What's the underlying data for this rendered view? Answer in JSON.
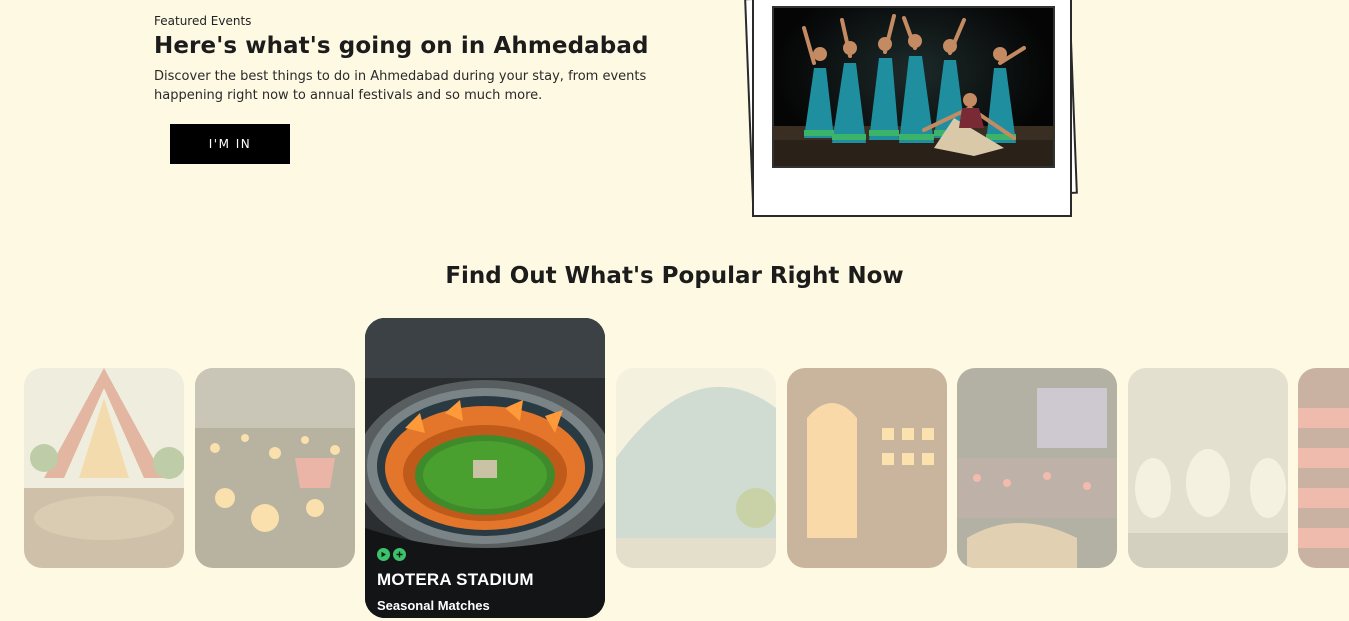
{
  "hero": {
    "eyebrow": "Featured Events",
    "title": "Here's what's going on in Ahmedabad",
    "description": "Discover the best things to do in Ahmedabad during your stay, from events happening right now to annual festivals and so much more.",
    "cta_label": "I'M IN"
  },
  "popular": {
    "title": "Find Out What's Popular Right Now",
    "active_card": {
      "name": "MOTERA STADIUM",
      "subtitle": "Seasonal Matches",
      "icons": [
        "play-icon",
        "plus-icon"
      ]
    }
  },
  "colors": {
    "background": "#fdf9e3",
    "accent_green": "#3cc26b",
    "button_bg": "#000000"
  }
}
